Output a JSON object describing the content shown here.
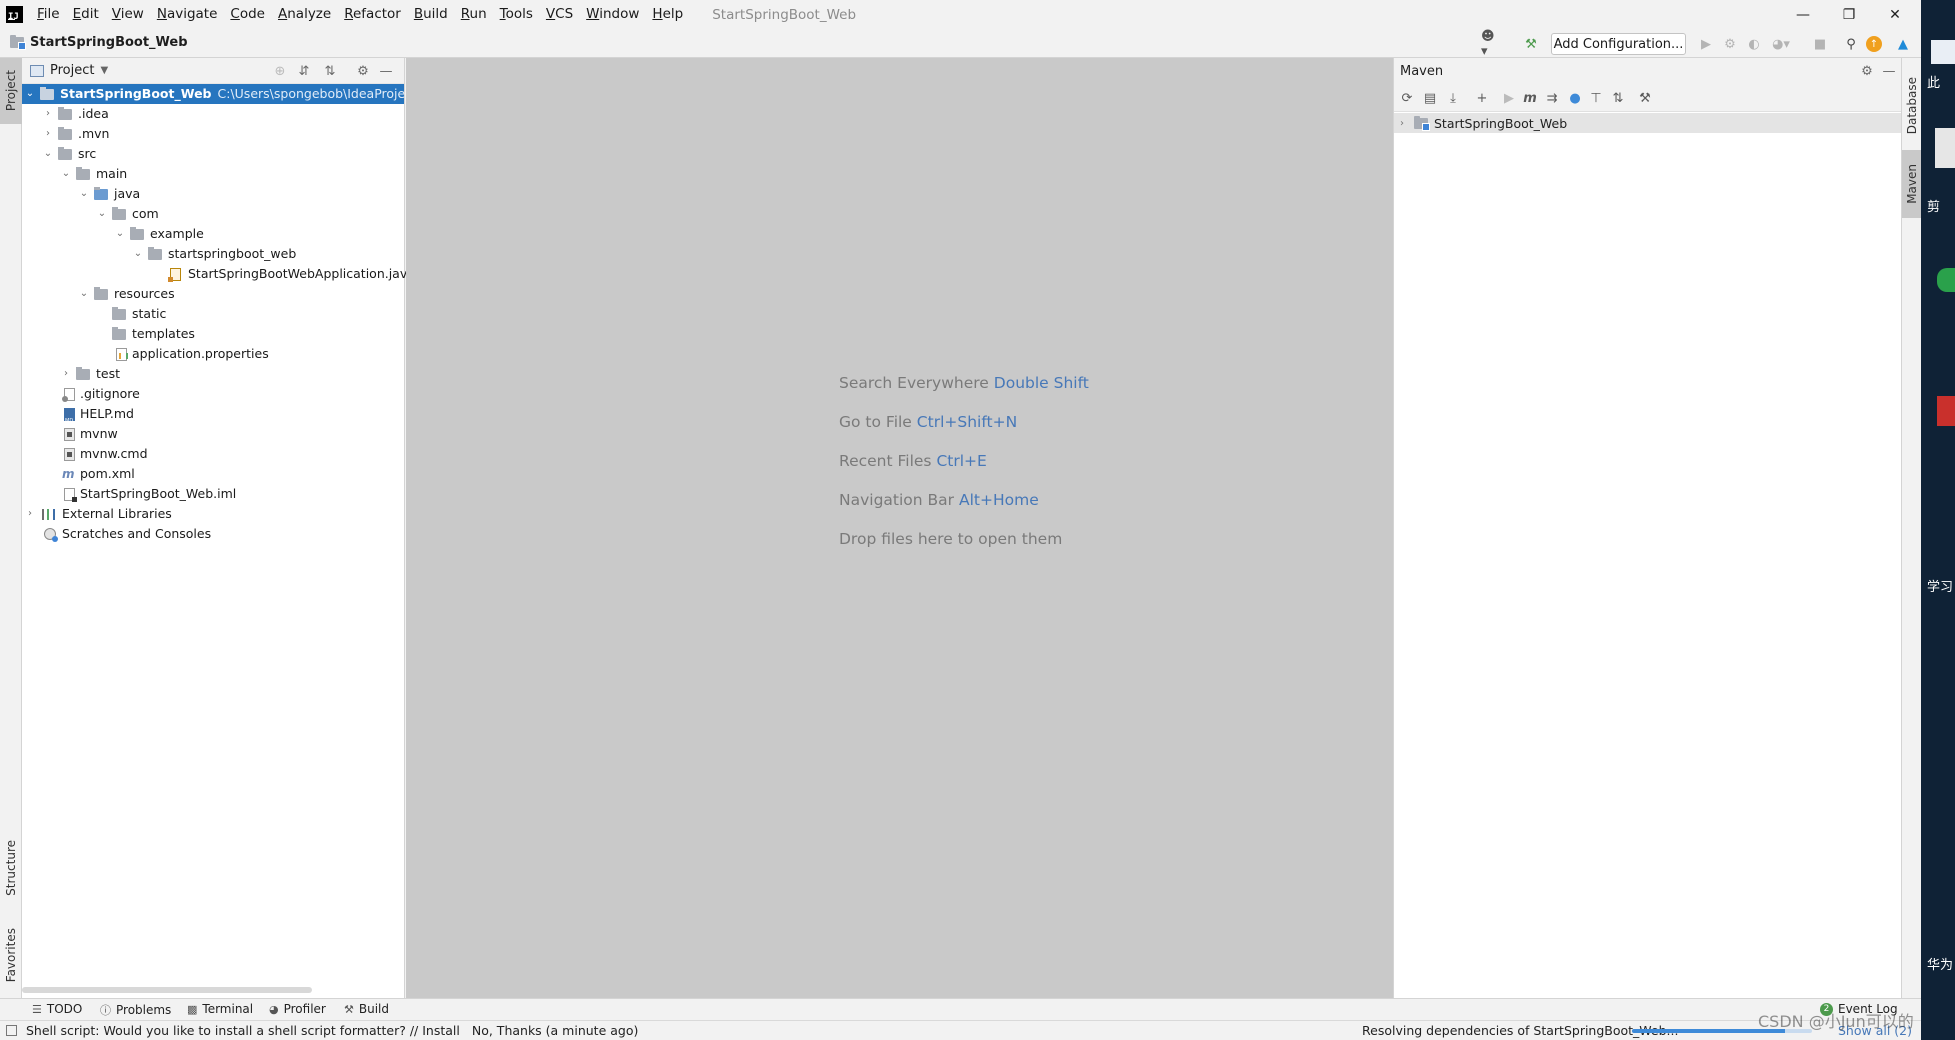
{
  "window": {
    "title": "StartSpringBoot_Web",
    "controls": [
      "minimize-icon",
      "restore-icon",
      "close-icon"
    ]
  },
  "menu": [
    "File",
    "Edit",
    "View",
    "Navigate",
    "Code",
    "Analyze",
    "Refactor",
    "Build",
    "Run",
    "Tools",
    "VCS",
    "Window",
    "Help"
  ],
  "navbar": {
    "project_name": "StartSpringBoot_Web",
    "add_configuration_label": "Add Configuration..."
  },
  "left_strip": {
    "project_tab": "Project",
    "structure_tab": "Structure",
    "favorites_tab": "Favorites"
  },
  "project_panel": {
    "title": "Project",
    "tree": [
      {
        "label": "StartSpringBoot_Web",
        "path": "C:\\Users\\spongebob\\IdeaProjects\\",
        "icon": "module-folder-icon",
        "expanded": true,
        "selected": true
      },
      {
        "label": ".idea",
        "icon": "folder-icon",
        "expanded": false
      },
      {
        "label": ".mvn",
        "icon": "folder-icon",
        "expanded": false
      },
      {
        "label": "src",
        "icon": "folder-icon",
        "expanded": true
      },
      {
        "label": "main",
        "icon": "folder-icon",
        "expanded": true
      },
      {
        "label": "java",
        "icon": "source-folder-icon",
        "expanded": true
      },
      {
        "label": "com",
        "icon": "package-icon",
        "expanded": true
      },
      {
        "label": "example",
        "icon": "package-icon",
        "expanded": true
      },
      {
        "label": "startspringboot_web",
        "icon": "package-icon",
        "expanded": true
      },
      {
        "label": "StartSpringBootWebApplication.java",
        "icon": "java-class-icon"
      },
      {
        "label": "resources",
        "icon": "resources-folder-icon",
        "expanded": true
      },
      {
        "label": "static",
        "icon": "folder-icon"
      },
      {
        "label": "templates",
        "icon": "folder-icon"
      },
      {
        "label": "application.properties",
        "icon": "properties-file-icon"
      },
      {
        "label": "test",
        "icon": "folder-icon",
        "expanded": false
      },
      {
        "label": ".gitignore",
        "icon": "gitignore-file-icon"
      },
      {
        "label": "HELP.md",
        "icon": "markdown-file-icon"
      },
      {
        "label": "mvnw",
        "icon": "script-file-icon"
      },
      {
        "label": "mvnw.cmd",
        "icon": "cmd-file-icon"
      },
      {
        "label": "pom.xml",
        "icon": "maven-pom-icon"
      },
      {
        "label": "StartSpringBoot_Web.iml",
        "icon": "iml-file-icon"
      },
      {
        "label": "External Libraries",
        "icon": "libraries-icon",
        "expanded": false
      },
      {
        "label": "Scratches and Consoles",
        "icon": "scratches-icon"
      }
    ]
  },
  "editor": {
    "hints": [
      {
        "text": "Search Everywhere",
        "key": "Double Shift"
      },
      {
        "text": "Go to File",
        "key": "Ctrl+Shift+N"
      },
      {
        "text": "Recent Files",
        "key": "Ctrl+E"
      },
      {
        "text": "Navigation Bar",
        "key": "Alt+Home"
      },
      {
        "text": "Drop files here to open them",
        "key": ""
      }
    ]
  },
  "maven_panel": {
    "title": "Maven",
    "project": "StartSpringBoot_Web"
  },
  "right_strip": {
    "database_tab": "Database",
    "maven_tab": "Maven"
  },
  "bottom_tabs": [
    "TODO",
    "Problems",
    "Terminal",
    "Profiler",
    "Build"
  ],
  "event_log": {
    "count": "2",
    "label": "Event Log"
  },
  "status": {
    "message": "Shell script: Would you like to install a shell script formatter? // Install",
    "message_suffix": "No, Thanks (a minute ago)",
    "background_task": "Resolving dependencies of StartSpringBoot_Web...",
    "progress": 0.85,
    "show_all": "Show all (2)"
  },
  "desktop_sliver": {
    "labels": [
      "此",
      "剪",
      "学习",
      "华为"
    ]
  },
  "watermark": "CSDN @小Jun可以的",
  "colors": {
    "selection": "#2675bf",
    "hint_key": "#4778b8",
    "editor_bg": "#c9c9c9",
    "panel_bg": "#ffffff",
    "chrome_bg": "#f2f2f2"
  }
}
